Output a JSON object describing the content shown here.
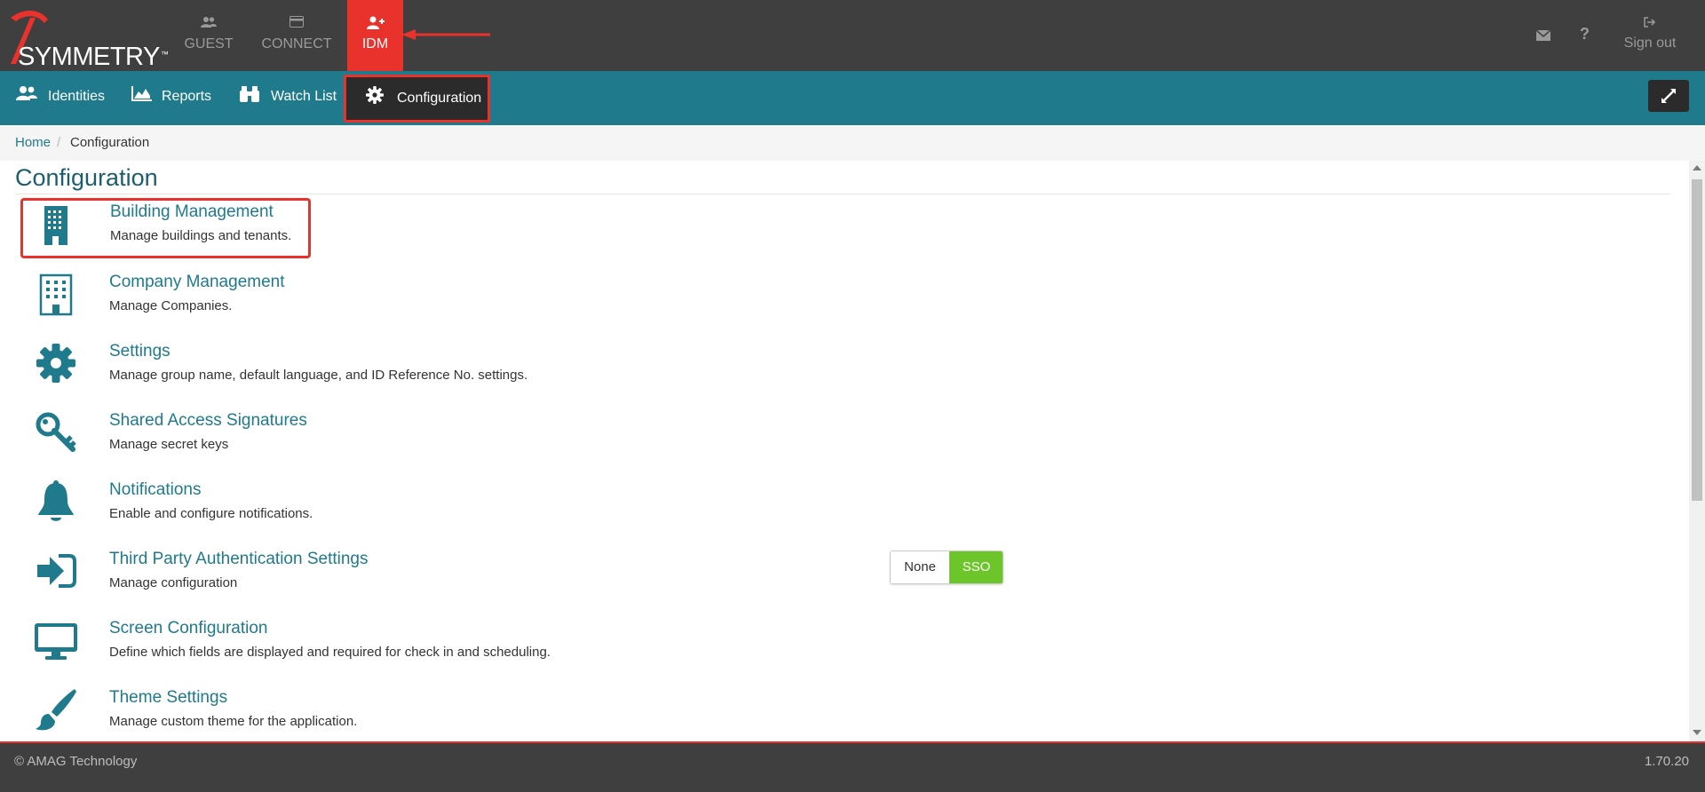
{
  "app": {
    "logo_text": "SYMMETRY",
    "logo_tm": "™"
  },
  "topnav": [
    {
      "label": "GUEST",
      "icon": "users-icon",
      "active": false
    },
    {
      "label": "CONNECT",
      "icon": "card-icon",
      "active": false
    },
    {
      "label": "IDM",
      "icon": "user-plus-icon",
      "active": true
    }
  ],
  "topright": {
    "mail_icon": "envelope-icon",
    "help_icon": "question-icon",
    "signout_label": "Sign out"
  },
  "subnav": [
    {
      "label": "Identities",
      "icon": "users-icon"
    },
    {
      "label": "Reports",
      "icon": "area-chart-icon"
    },
    {
      "label": "Watch List",
      "icon": "binoculars-icon"
    },
    {
      "label": "Configuration",
      "icon": "gear-icon",
      "active": true
    }
  ],
  "breadcrumb": {
    "home": "Home",
    "separator": "/",
    "current": "Configuration"
  },
  "page": {
    "title": "Configuration"
  },
  "items": [
    {
      "title": "Building Management",
      "desc": "Manage buildings and tenants.",
      "icon": "building-icon"
    },
    {
      "title": "Company Management",
      "desc": "Manage Companies.",
      "icon": "building-outline-icon"
    },
    {
      "title": "Settings",
      "desc": "Manage group name, default language, and ID Reference No. settings.",
      "icon": "gear-icon"
    },
    {
      "title": "Shared Access Signatures",
      "desc": "Manage secret keys",
      "icon": "key-icon"
    },
    {
      "title": "Notifications",
      "desc": "Enable and configure notifications.",
      "icon": "bell-icon"
    },
    {
      "title": "Third Party Authentication Settings",
      "desc": "Manage configuration",
      "icon": "sign-in-icon"
    },
    {
      "title": "Screen Configuration",
      "desc": "Define which fields are displayed and required for check in and scheduling.",
      "icon": "monitor-icon"
    },
    {
      "title": "Theme Settings",
      "desc": "Manage custom theme for the application.",
      "icon": "paintbrush-icon"
    }
  ],
  "auth_toggle": {
    "options": [
      "None",
      "SSO"
    ],
    "selected": "SSO"
  },
  "footer": {
    "copyright": "© AMAG Technology",
    "version": "1.70.20"
  },
  "colors": {
    "topbar": "#3f3f3f",
    "accent_red": "#e8322b",
    "teal": "#1f7a8c",
    "sso_green": "#6cc62a"
  }
}
